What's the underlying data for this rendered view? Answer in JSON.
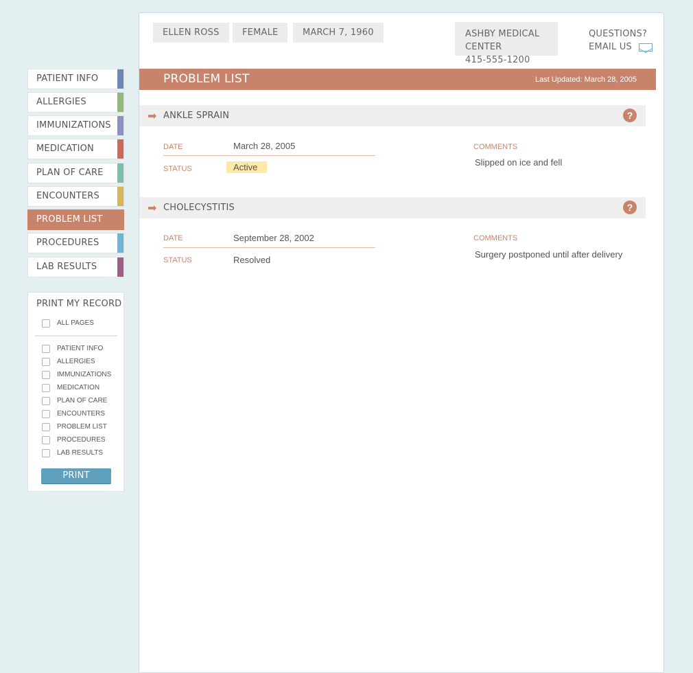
{
  "header": {
    "patient_name": "ELLEN ROSS",
    "sex": "FEMALE",
    "dob": "MARCH 7, 1960",
    "center_name": "ASHBY MEDICAL CENTER",
    "center_phone": "415-555-1200",
    "questions": "QUESTIONS?",
    "email_us": "EMAIL US"
  },
  "page": {
    "title": "PROBLEM LIST",
    "last_updated": "Last Updated: March 28, 2005"
  },
  "labels": {
    "date": "DATE",
    "status": "STATUS",
    "comments": "COMMENTS",
    "help": "?"
  },
  "problems": [
    {
      "name": "ANKLE SPRAIN",
      "date": "March 28, 2005",
      "status": "Active",
      "comments": "Slipped on ice and fell"
    },
    {
      "name": "CHOLECYSTITIS",
      "date": "September 28, 2002",
      "status": "Resolved",
      "comments": "Surgery postponed until after delivery"
    }
  ],
  "sidebar": {
    "items": [
      {
        "label": "PATIENT INFO",
        "color": "#6c87b8"
      },
      {
        "label": "ALLERGIES",
        "color": "#8fba7b"
      },
      {
        "label": "IMMUNIZATIONS",
        "color": "#8e8fc4"
      },
      {
        "label": "MEDICATION",
        "color": "#cc6a5a"
      },
      {
        "label": "PLAN OF CARE",
        "color": "#7bbfad"
      },
      {
        "label": "ENCOUNTERS",
        "color": "#d8b45a"
      },
      {
        "label": "PROBLEM LIST",
        "color": "#c8846a"
      },
      {
        "label": "PROCEDURES",
        "color": "#6cb5d6"
      },
      {
        "label": "LAB RESULTS",
        "color": "#9c5f86"
      }
    ],
    "active": "PROBLEM LIST"
  },
  "print": {
    "title": "PRINT MY RECORD",
    "all_pages": "ALL PAGES",
    "options": [
      "PATIENT INFO",
      "ALLERGIES",
      "IMMUNIZATIONS",
      "MEDICATION",
      "PLAN OF CARE",
      "ENCOUNTERS",
      "PROBLEM LIST",
      "PROCEDURES",
      "LAB RESULTS"
    ],
    "button": "PRINT"
  }
}
